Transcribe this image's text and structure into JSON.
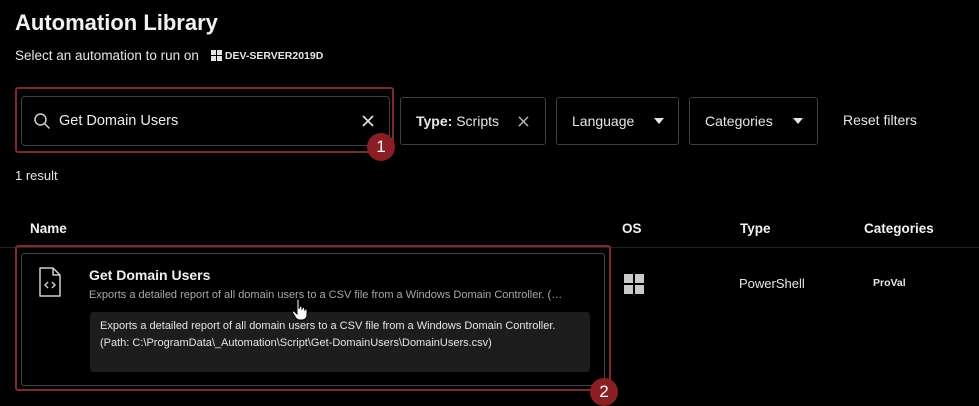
{
  "page": {
    "title": "Automation Library",
    "subtitle": "Select an automation to run on",
    "server_name": "DEV-SERVER2019D"
  },
  "search": {
    "value": "Get Domain Users",
    "placeholder": ""
  },
  "badges": {
    "first": "1",
    "second": "2"
  },
  "filters": {
    "type_label": "Type:",
    "type_value": "Scripts",
    "language_label": "Language",
    "categories_label": "Categories",
    "reset_label": "Reset filters"
  },
  "results": {
    "count_text": "1 result"
  },
  "table": {
    "headers": {
      "name": "Name",
      "os": "OS",
      "type": "Type",
      "categories": "Categories"
    },
    "rows": [
      {
        "title": "Get Domain Users",
        "description": "Exports a detailed report of all domain users to a CSV file from a Windows Domain Controller. (Path: C:\\ProgramData\\_Automation\\Script\\Get-DomainUsers\\DomainUsers.csv)",
        "tooltip": "Exports a detailed report of all domain users to a CSV file from a Windows Domain Controller. (Path: C:\\ProgramData\\_Automation\\Script\\Get-DomainUsers\\DomainUsers.csv)",
        "os_icon": "windows-icon",
        "type": "PowerShell",
        "category": "ProVal"
      }
    ]
  },
  "colors": {
    "background": "#000000",
    "highlight_border": "#7e2a2f",
    "badge": "#8b1d24",
    "tooltip_bg": "#1d1d1d"
  }
}
